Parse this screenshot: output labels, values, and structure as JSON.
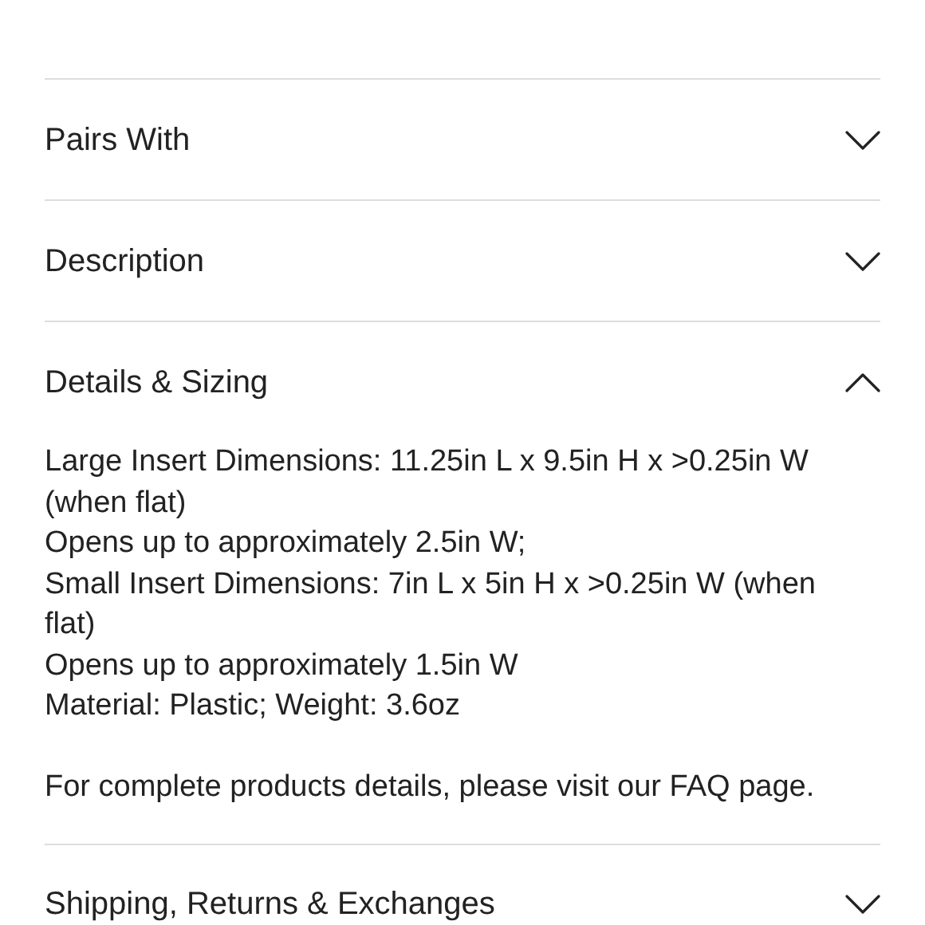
{
  "sections": [
    {
      "title": "Pairs With",
      "expanded": false
    },
    {
      "title": "Description",
      "expanded": false
    },
    {
      "title": "Details & Sizing",
      "expanded": true,
      "lines": [
        "Large Insert Dimensions: 11.25in L x 9.5in H x >0.25in W (when flat)",
        "Opens up to approximately 2.5in W;",
        "Small Insert Dimensions: 7in L x 5in H x >0.25in W (when flat)",
        "Opens up to approximately 1.5in W",
        "Material: Plastic; Weight: 3.6oz"
      ],
      "note": "For complete products details, please visit our FAQ page."
    },
    {
      "title": "Shipping, Returns & Exchanges",
      "expanded": false
    }
  ]
}
